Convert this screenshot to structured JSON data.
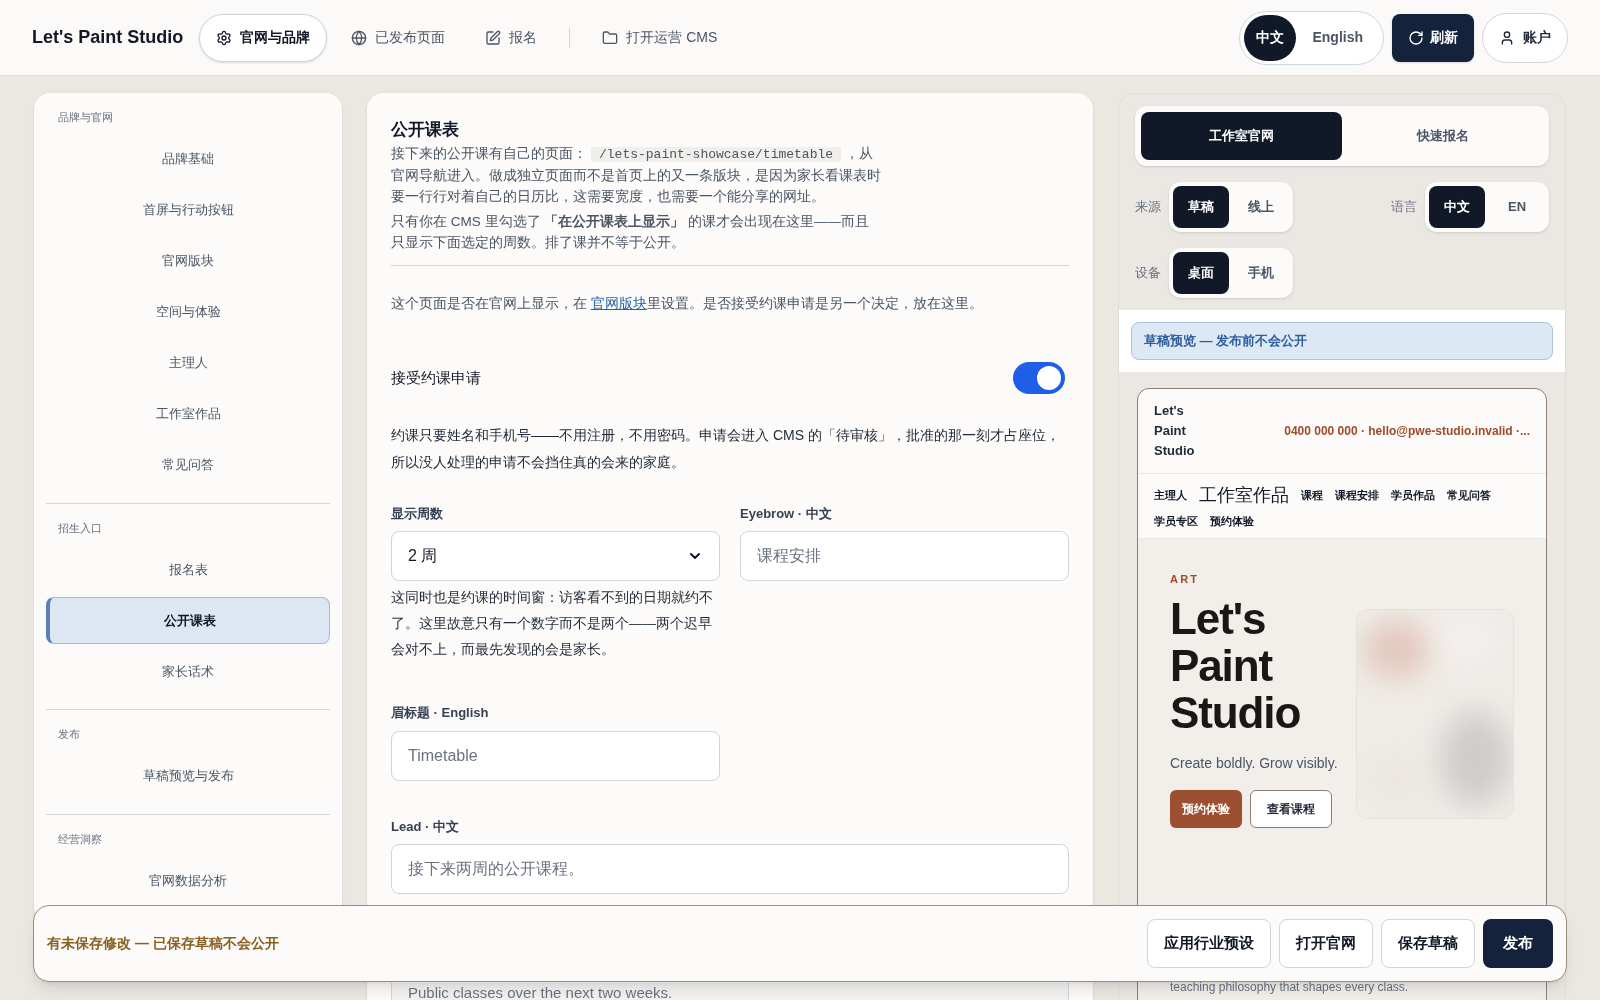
{
  "header": {
    "brand": "Let's Paint Studio",
    "nav": [
      {
        "label": "官网与品牌",
        "kind": "gear",
        "selected": true
      },
      {
        "label": "已发布页面",
        "kind": "globe",
        "selected": false
      },
      {
        "label": "报名",
        "kind": "pencil",
        "selected": false
      },
      {
        "label": "打开运营 CMS",
        "kind": "folder",
        "selected": false
      }
    ],
    "languages": [
      {
        "label": "中文",
        "selected": true
      },
      {
        "label": "English",
        "selected": false
      }
    ],
    "refresh": "刷新",
    "account": "账户"
  },
  "sidebar": {
    "groups": [
      {
        "title": "品牌与官网",
        "items": [
          {
            "label": "品牌基础",
            "selected": false
          },
          {
            "label": "首屏与行动按钮",
            "selected": false
          },
          {
            "label": "官网版块",
            "selected": false
          },
          {
            "label": "空间与体验",
            "selected": false
          },
          {
            "label": "主理人",
            "selected": false
          },
          {
            "label": "工作室作品",
            "selected": false
          },
          {
            "label": "常见问答",
            "selected": false
          }
        ]
      },
      {
        "title": "招生入口",
        "items": [
          {
            "label": "报名表",
            "selected": false
          },
          {
            "label": "公开课表",
            "selected": true
          },
          {
            "label": "家长话术",
            "selected": false
          }
        ]
      },
      {
        "title": "发布",
        "items": [
          {
            "label": "草稿预览与发布",
            "selected": false
          }
        ]
      },
      {
        "title": "经营洞察",
        "items": [
          {
            "label": "官网数据分析",
            "selected": false
          }
        ]
      }
    ]
  },
  "editor": {
    "title": "公开课表",
    "intro_before": "接下来的公开课有自己的页面：",
    "path": "/lets-paint-showcase/timetable",
    "intro_after": "，从官网导航进入。做成独立页面而不是首页上的又一条版块，是因为家长看课表时要一行行对着自己的日历比，这需要宽度，也需要一个能分享的网址。",
    "note": "只有你在 CMS 里勾选了 **「在公开课表上显示」** 的课才会出现在这里——而且只显示下面选定的周数。排了课并不等于公开。",
    "visibility_before": "这个页面是否在官网上显示，在 ",
    "visibility_link": "官网版块",
    "visibility_after": "里设置。是否接受约课申请是另一个决定，放在这里。",
    "toggle": {
      "label": "接受约课申请",
      "on": true
    },
    "toggle_help": "约课只要姓名和手机号——不用注册，不用密码。申请会进入 CMS 的「待审核」，批准的那一刻才占座位，所以没人处理的申请不会挡住真的会来的家庭。",
    "weeks": {
      "label": "显示周数",
      "value": "2 周",
      "help": "这同时也是约课的时间窗：访客看不到的日期就约不了。这里故意只有一个数字而不是两个——两个迟早会对不上，而最先发现的会是家长。"
    },
    "eyebrow_zh": {
      "label": "Eyebrow · 中文",
      "placeholder": "课程安排"
    },
    "eyebrow_en": {
      "label": "眉标题 · English",
      "placeholder": "Timetable"
    },
    "lead_zh": {
      "label": "Lead · 中文",
      "placeholder": "接下来两周的公开课程。"
    },
    "lead_en": {
      "placeholder": "Public classes over the next two weeks."
    }
  },
  "preview": {
    "tabs": [
      {
        "label": "工作室官网",
        "selected": true
      },
      {
        "label": "快速报名",
        "selected": false
      }
    ],
    "source": {
      "label": "来源",
      "options": [
        {
          "label": "草稿",
          "selected": true
        },
        {
          "label": "线上",
          "selected": false
        }
      ]
    },
    "language": {
      "label": "语言",
      "options": [
        {
          "label": "中文",
          "selected": true
        },
        {
          "label": "EN",
          "selected": false
        }
      ]
    },
    "device": {
      "label": "设备",
      "options": [
        {
          "label": "桌面",
          "selected": true
        },
        {
          "label": "手机",
          "selected": false
        }
      ]
    },
    "banner": "草稿预览 — 发布前不会公开",
    "site": {
      "brand": "Let's Paint Studio",
      "contact": "0400 000 000 · hello@pwe-studio.invalid ·...",
      "nav": [
        {
          "label": "主理人",
          "kind": "small"
        },
        {
          "label": "工作室作品",
          "kind": "large"
        },
        {
          "label": "课程",
          "kind": "small"
        },
        {
          "label": "课程安排",
          "kind": "small"
        },
        {
          "label": "学员作品",
          "kind": "small"
        },
        {
          "label": "常见问答",
          "kind": "small"
        },
        {
          "label": "学员专区",
          "kind": "small"
        },
        {
          "label": "预约体验",
          "kind": "small"
        }
      ],
      "eyebrow": "ART",
      "title": "Let's Paint Studio",
      "tagline": "Create boldly. Grow visibly.",
      "primary": "预约体验",
      "secondary": "查看课程",
      "below": "teaching philosophy that shapes every class."
    }
  },
  "footer": {
    "status": "有未保存修改 — 已保存草稿不会公开",
    "actions": [
      {
        "label": "应用行业预设",
        "kind": "outline"
      },
      {
        "label": "打开官网",
        "kind": "outline"
      },
      {
        "label": "保存草稿",
        "kind": "outline"
      },
      {
        "label": "发布",
        "kind": "primary"
      }
    ]
  }
}
